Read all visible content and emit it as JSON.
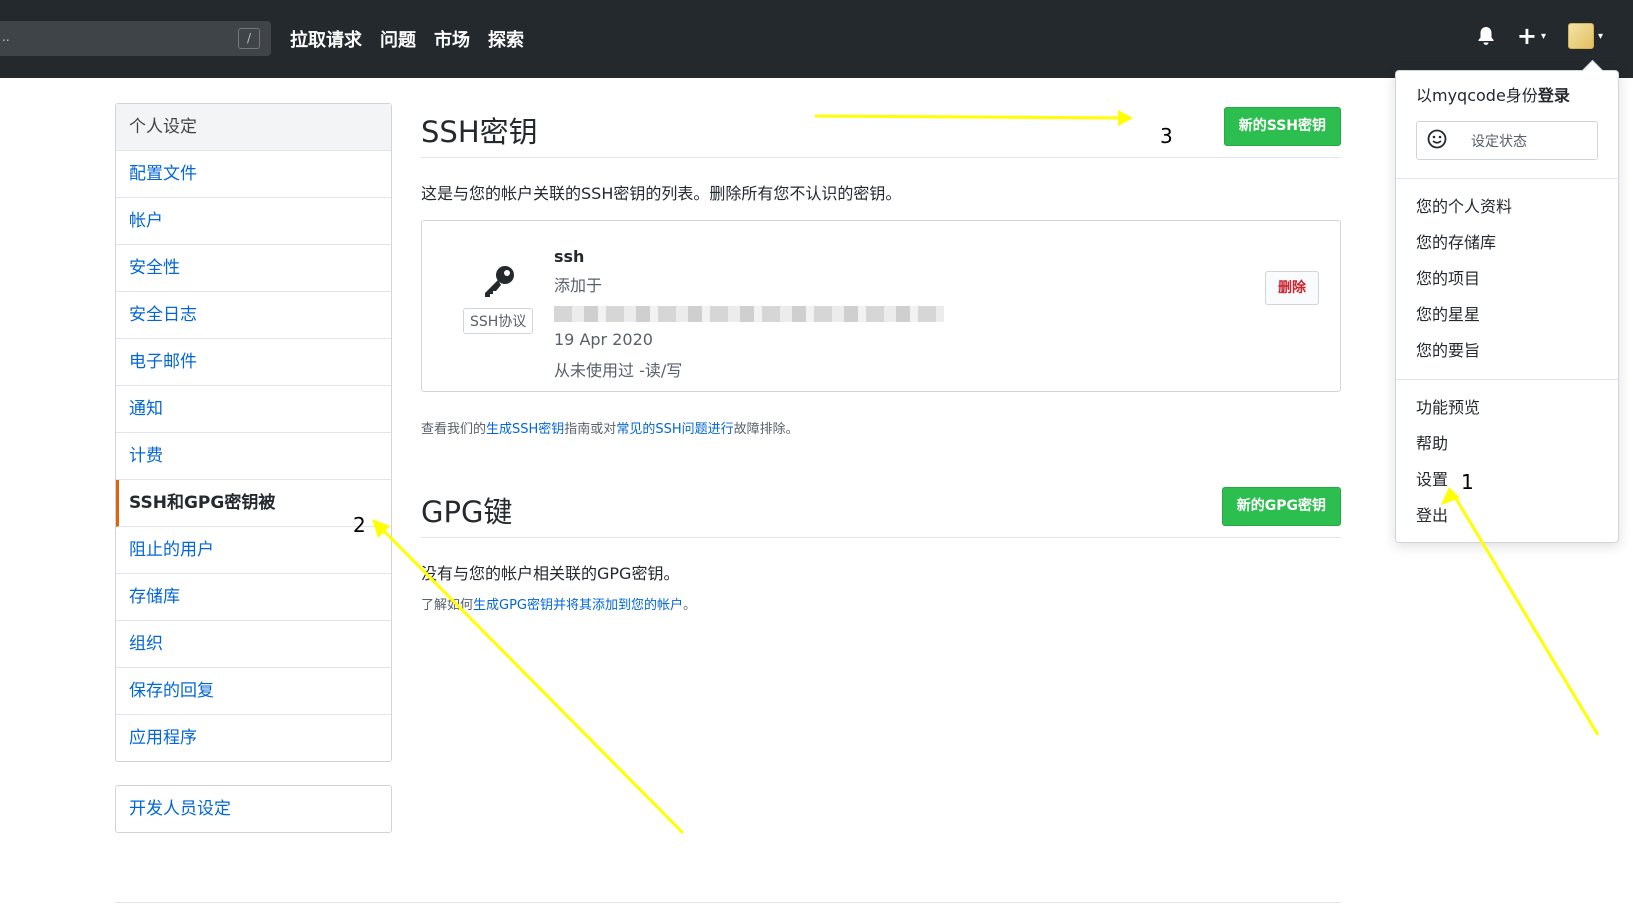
{
  "header": {
    "search_dots": "..",
    "search_shortcut": "/",
    "nav": [
      "拉取请求",
      "问题",
      "市场",
      "探索"
    ],
    "plus": "+",
    "caret": "▾"
  },
  "sidebar": {
    "title": "个人设定",
    "items": [
      "配置文件",
      "帐户",
      "安全性",
      "安全日志",
      "电子邮件",
      "通知",
      "计费",
      "SSH和GPG密钥被",
      "阻止的用户",
      "存储库",
      "组织",
      "保存的回复",
      "应用程序"
    ],
    "selected": "SSH和GPG密钥被",
    "developer": "开发人员设定"
  },
  "ssh": {
    "title": "SSH密钥",
    "new_button": "新的SSH密钥",
    "description": "这是与您的帐户关联的SSH密钥的列表。删除所有您不认识的密钥。",
    "key": {
      "name": "ssh",
      "added_label": "添加于",
      "badge": "SSH协议",
      "date": "19 Apr 2020",
      "usage": "从未使用过 -读/写",
      "delete_button": "删除"
    },
    "help": {
      "prefix": "查看我们的",
      "link1": "生成SSH密钥",
      "middle": "指南或对",
      "link2": "常见的SSH问题进行",
      "suffix": "故障排除。"
    }
  },
  "gpg": {
    "title": "GPG键",
    "new_button": "新的GPG密钥",
    "none_text": "没有与您的帐户相关联的GPG密钥。",
    "help": {
      "prefix": "了解如何",
      "link": "生成GPG密钥并将其添加到您的帐户",
      "suffix": "。"
    }
  },
  "dropdown": {
    "signed_prefix": "以myqcode身份",
    "signed_bold": "登录",
    "set_status": "设定状态",
    "group1": [
      "您的个人资料",
      "您的存储库",
      "您的项目",
      "您的星星",
      "您的要旨"
    ],
    "group2": [
      "功能预览",
      "帮助",
      "设置",
      "登出"
    ]
  },
  "annotations": {
    "label_1": "1",
    "label_2": "2",
    "label_3": "3",
    "arrow_color": "#ffff00"
  }
}
